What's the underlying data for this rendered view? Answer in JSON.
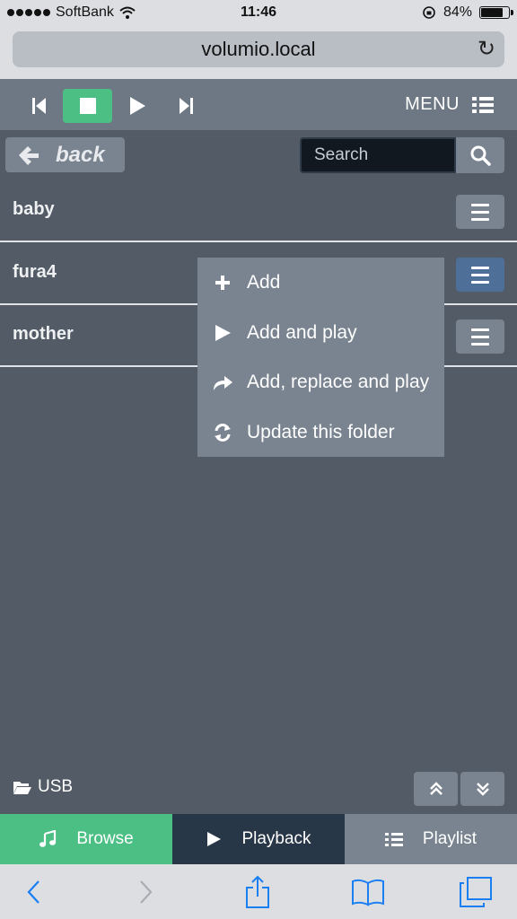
{
  "status_bar": {
    "carrier": "SoftBank",
    "time": "11:46",
    "battery_percent": "84%",
    "battery_level": 0.84
  },
  "address_bar": {
    "url": "volumio.local"
  },
  "player": {
    "menu_label": "MENU"
  },
  "browse": {
    "back_label": "back",
    "search_placeholder": "Search",
    "folders": [
      {
        "name": "baby"
      },
      {
        "name": "fura4"
      },
      {
        "name": "mother"
      }
    ]
  },
  "context_menu": {
    "items": [
      {
        "label": "Add",
        "icon": "plus-icon"
      },
      {
        "label": "Add and play",
        "icon": "play-icon"
      },
      {
        "label": "Add, replace and play",
        "icon": "share-arrow-icon"
      },
      {
        "label": "Update this folder",
        "icon": "refresh-icon"
      }
    ]
  },
  "footer": {
    "source_label": "USB"
  },
  "tabs": [
    {
      "label": "Browse",
      "icon": "music-note-icon"
    },
    {
      "label": "Playback",
      "icon": "play-icon"
    },
    {
      "label": "Playlist",
      "icon": "list-icon"
    }
  ],
  "colors": {
    "accent_green": "#4cbf85",
    "playback_tab": "#283747",
    "panel_gray": "#7a8490",
    "background": "#525b66",
    "active_menu_button": "#4e6f98",
    "ios_blue": "#1a7ff2"
  }
}
